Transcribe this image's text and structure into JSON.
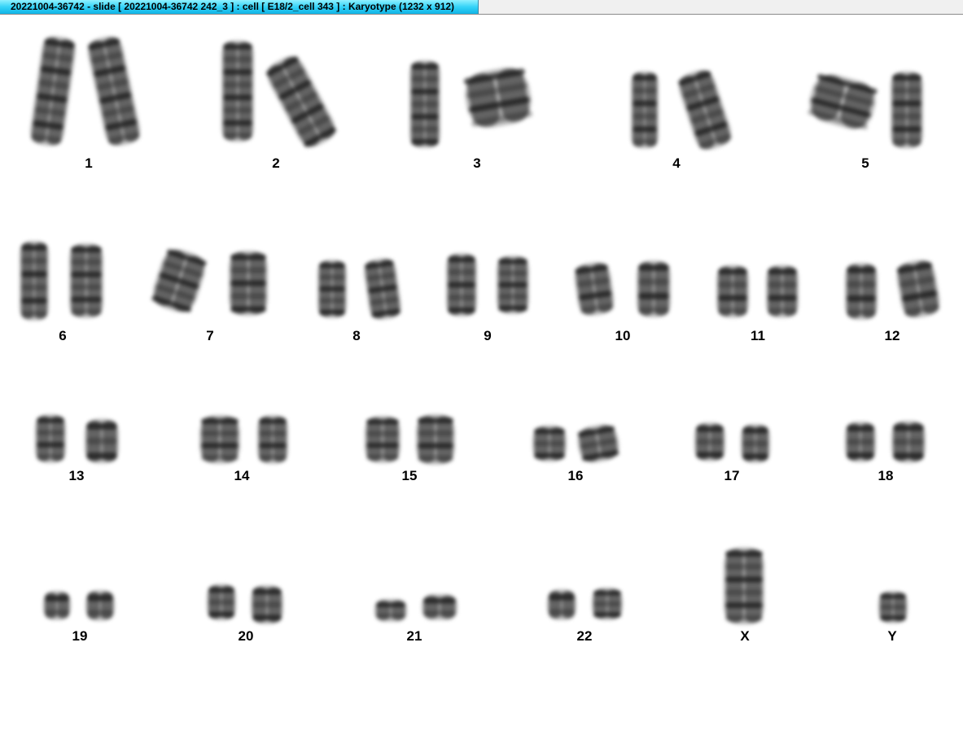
{
  "window": {
    "title": "20221004-36742 - slide [ 20221004-36742 242_3 ] : cell [ E18/2_cell 343 ] : Karyotype  (1232 x 912)"
  },
  "karyotype": {
    "labels": [
      "1",
      "2",
      "3",
      "4",
      "5",
      "6",
      "7",
      "8",
      "9",
      "10",
      "11",
      "12",
      "13",
      "14",
      "15",
      "16",
      "17",
      "18",
      "19",
      "20",
      "21",
      "22",
      "X",
      "Y"
    ]
  },
  "colors": {
    "titlebar_accent": "#34d3f7",
    "chromosome_stain": "#1a1a1a",
    "background": "#ffffff"
  }
}
